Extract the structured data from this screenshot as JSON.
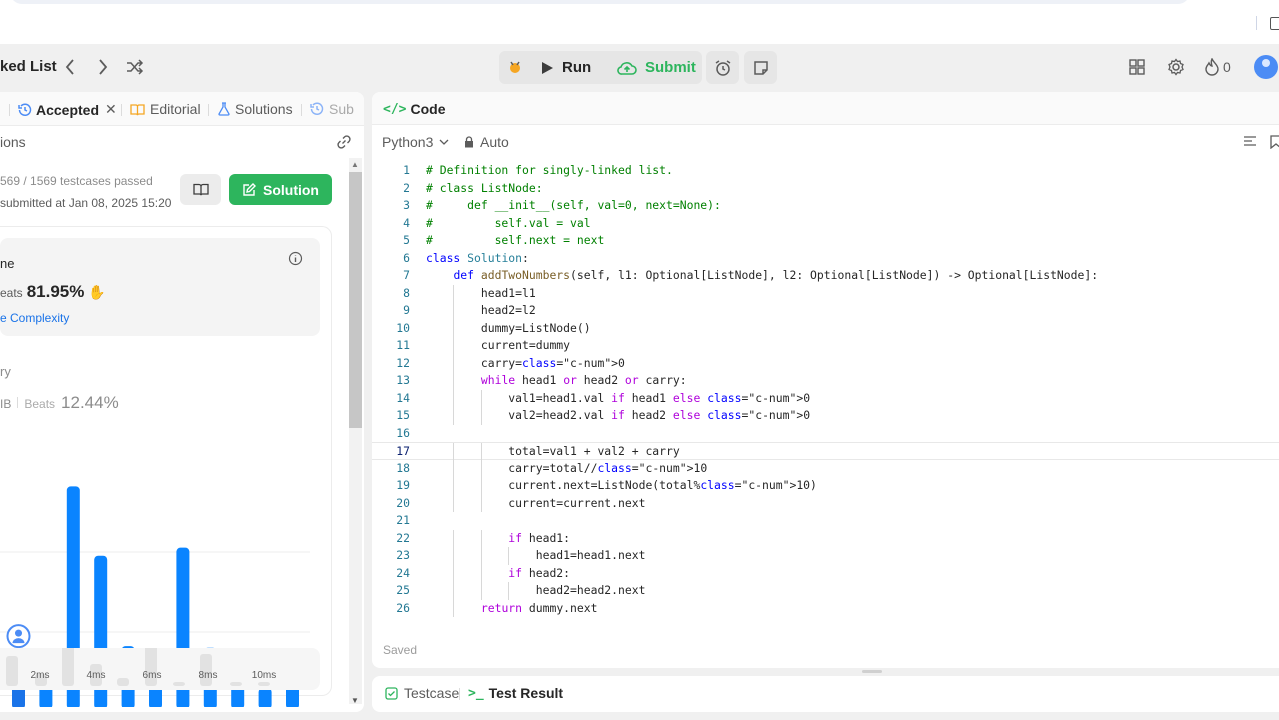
{
  "header": {
    "problem_title": "ked List",
    "run_label": "Run",
    "submit_label": "Submit",
    "fire_count": "0"
  },
  "left": {
    "tabs": [
      "Accepted",
      "Editorial",
      "Solutions",
      "Sub"
    ],
    "section_title": "ions",
    "testcases": "569 / 1569 testcases passed",
    "submitted": "submitted at Jan 08, 2025 15:20",
    "solution_label": "Solution",
    "runtime_label": "ne",
    "beats_prefix": "eats",
    "runtime_beats": "81.95%",
    "complexity_link": "e Complexity",
    "memory_label": "ry",
    "memory_unit": "IB",
    "memory_beats_prefix": "Beats",
    "memory_beats": "12.44%"
  },
  "chart_data": {
    "type": "bar",
    "categories": [
      "",
      "",
      "",
      "",
      "",
      "",
      "",
      "",
      "",
      "",
      ""
    ],
    "values": [
      34,
      35,
      138,
      95,
      39,
      33,
      100,
      38,
      16,
      13,
      34
    ],
    "highlight_index": 0,
    "xticks": [
      "2ms",
      "4ms",
      "6ms",
      "8ms",
      "10ms"
    ],
    "mini_values": [
      30,
      12,
      44,
      22,
      8,
      48,
      2,
      32,
      2,
      4
    ],
    "mini_ticks": [
      "2ms",
      "4ms",
      "6ms",
      "8ms",
      "10ms"
    ],
    "colors": {
      "bar": "#0a84ff",
      "highlight": "#1a73e8",
      "mini": "#e2e2e2"
    }
  },
  "code": {
    "tab_label": "Code",
    "language": "Python3",
    "mode": "Auto",
    "saved": "Saved",
    "lines": [
      "# Definition for singly-linked list.",
      "# class ListNode:",
      "#     def __init__(self, val=0, next=None):",
      "#         self.val = val",
      "#         self.next = next",
      "class Solution:",
      "    def addTwoNumbers(self, l1: Optional[ListNode], l2: Optional[ListNode]) -> Optional[ListNode]:",
      "        head1=l1",
      "        head2=l2",
      "        dummy=ListNode()",
      "        current=dummy",
      "        carry=0",
      "        while head1 or head2 or carry:",
      "            val1=head1.val if head1 else 0",
      "            val2=head2.val if head2 else 0",
      "",
      "            total=val1 + val2 + carry",
      "            carry=total//10",
      "            current.next=ListNode(total%10)",
      "            current=current.next",
      "",
      "            if head1:",
      "                head1=head1.next",
      "            if head2:",
      "                head2=head2.next",
      "        return dummy.next"
    ]
  },
  "bottom": {
    "testcase_label": "Testcase",
    "test_result_label": "Test Result"
  }
}
